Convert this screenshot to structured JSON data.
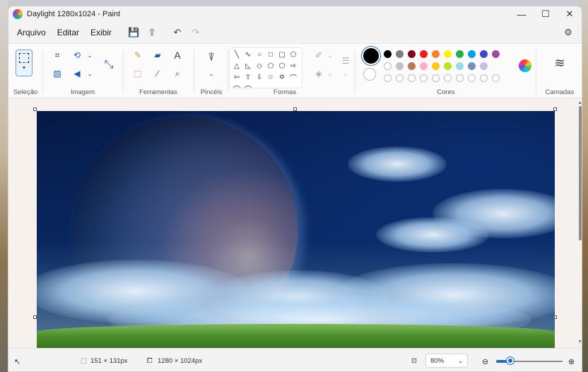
{
  "window": {
    "title": "Daylight 1280x1024 - Paint",
    "controls": {
      "minimize": "—",
      "maximize": "☐",
      "close": "✕"
    }
  },
  "menubar": {
    "items": [
      {
        "label": "Arquivo"
      },
      {
        "label": "Editar"
      },
      {
        "label": "Exibir"
      }
    ],
    "icons": {
      "save": "💾",
      "share": "⇪",
      "undo": "↶",
      "redo": "↷",
      "settings": "⚙"
    }
  },
  "ribbon": {
    "groups": {
      "selection": "Seleção",
      "image": "Imagem",
      "tools": "Ferramentas",
      "brushes": "Pincéis",
      "shapes": "Formas",
      "colors": "Cores",
      "layers": "Camadas"
    },
    "image_icons": {
      "crop": "⌗",
      "rotate": "⟲",
      "flip": "◀",
      "resize": "⤡",
      "remove_bg": "▨"
    },
    "tool_icons": {
      "pencil": "✎",
      "fill": "▰",
      "text": "A",
      "eraser": "⬚",
      "picker": "⁄",
      "magnifier": "⌕"
    },
    "brush_icon": "⍒",
    "shape_glyphs": [
      "╲",
      "∿",
      "○",
      "□",
      "▢",
      "⬠",
      "△",
      "◺",
      "◇",
      "⬠",
      "⬡",
      "⇨",
      "⇦",
      "⇧",
      "⇩",
      "☆",
      "✡",
      "⌒",
      "⌒",
      "⌒"
    ],
    "colors": {
      "row1": [
        "#000000",
        "#7f7f7f",
        "#880015",
        "#ed1c24",
        "#ff7f27",
        "#fff200",
        "#22b14c",
        "#00a2e8",
        "#3f48cc",
        "#a349a4"
      ],
      "row2": [
        "#ffffff",
        "#c3c3c3",
        "#b97a57",
        "#ffaec9",
        "#ffc90e",
        "#b5e61d",
        "#99d9ea",
        "#7092be",
        "#c8bfe7"
      ],
      "primary": "#000000",
      "secondary": "#ffffff"
    }
  },
  "status": {
    "selection_size": "151 × 131px",
    "image_size": "1280 × 1024px",
    "zoom": "80%",
    "zoom_percent": 80
  }
}
